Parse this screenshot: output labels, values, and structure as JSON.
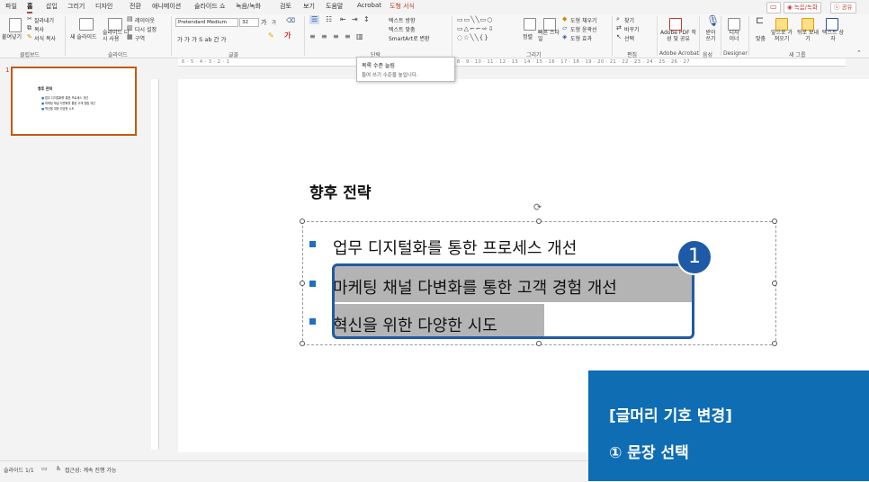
{
  "menu": {
    "tabs": [
      "파일",
      "홈",
      "삽입",
      "그리기",
      "디자인",
      "전환",
      "애니메이션",
      "슬라이드 쇼",
      "녹음/녹화",
      "검토",
      "보기",
      "도움말",
      "Acrobat",
      "도형 서식"
    ],
    "active_tab": "홈",
    "record_button": "◉ 녹음/녹화",
    "share_button": "ⓢ 공유"
  },
  "ribbon": {
    "clipboard": {
      "paste": "붙여넣기",
      "cut": "잘라내기",
      "copy": "복사",
      "format_painter": "서식 복사",
      "group": "클립보드"
    },
    "slides": {
      "new_slide": "새 슬라이드",
      "reuse": "슬라이드 다시 사용",
      "layout": "레이아웃",
      "reset": "다시 설정",
      "section": "구역",
      "group": "슬라이드"
    },
    "font": {
      "font_name": "Pretendard Medium",
      "font_size": "32",
      "grow": "가",
      "shrink": "가",
      "format_row": "가 가 가 S ab 간 가",
      "group": "글꼴"
    },
    "paragraph": {
      "text_direction": "텍스트 방향",
      "align_text": "텍스트 맞춤",
      "smartart": "SmartArt로 변환",
      "group": "단락"
    },
    "drawing": {
      "arrange": "정렬",
      "quick_styles": "빠른 스타일",
      "shape_fill": "도형 채우기",
      "shape_outline": "도형 윤곽선",
      "shape_effects": "도형 효과",
      "group": "그리기"
    },
    "editing": {
      "find": "찾기",
      "replace": "바꾸기",
      "select": "선택",
      "group": "편집"
    },
    "acrobat": {
      "create_pdf": "Adobe PDF 작성 및 공유",
      "group": "Adobe Acrobat"
    },
    "voice": {
      "dictate": "받아 쓰기",
      "group": "음성"
    },
    "designer": {
      "design": "디자 이너",
      "group": "Designer"
    },
    "new_group": {
      "align": "맞춤",
      "bring_forward": "앞으로 가져오기",
      "send_backward": "뒤로 보내기",
      "textbox": "텍스트 상자",
      "group": "새 그룹"
    }
  },
  "tooltip": {
    "title": "목록 수준 늘림",
    "desc": "들여 쓰기 수준을 높입니다."
  },
  "ruler": {
    "h_left": "6 · 5 · 4 · 3 · 2 · 1",
    "h_right": "8 · 9 · 10 · 11 · 12 · 13 · 14 · 15 · 16 · 17 · 18 · 19 · 20 · 21 · 22 · 23 · 24 · 25 · 26 · 27"
  },
  "thumbnail": {
    "number": "1",
    "title": "향후 전략",
    "bullets": [
      "업무 디지털화를 통한 프로세스 개선",
      "마케팅 채널 다변화를 통한 고객 경험 개선",
      "혁신을 위한 다양한 시도"
    ]
  },
  "slide": {
    "title": "향후 전략",
    "bullets": [
      "업무 디지털화를 통한 프로세스 개선",
      "마케팅 채널 다변화를 통한 고객 경험 개선",
      "혁신을 위한 다양한 시도"
    ],
    "selected_bullets": [
      2,
      3
    ],
    "callout_number": "1"
  },
  "instruction": {
    "heading": "[글머리 기호 변경]",
    "step": "① 문장 선택"
  },
  "status_bar": {
    "slide_count": "슬라이드 1/1",
    "accessibility": "접근성: 계속 진행 가능"
  },
  "colors": {
    "accent_orange": "#c55a11",
    "bullet_blue": "#1f6fc5",
    "callout_blue": "#1f5aa6",
    "instruction_bg": "#0f6db4",
    "selection_gray": "#b4b4b4"
  }
}
